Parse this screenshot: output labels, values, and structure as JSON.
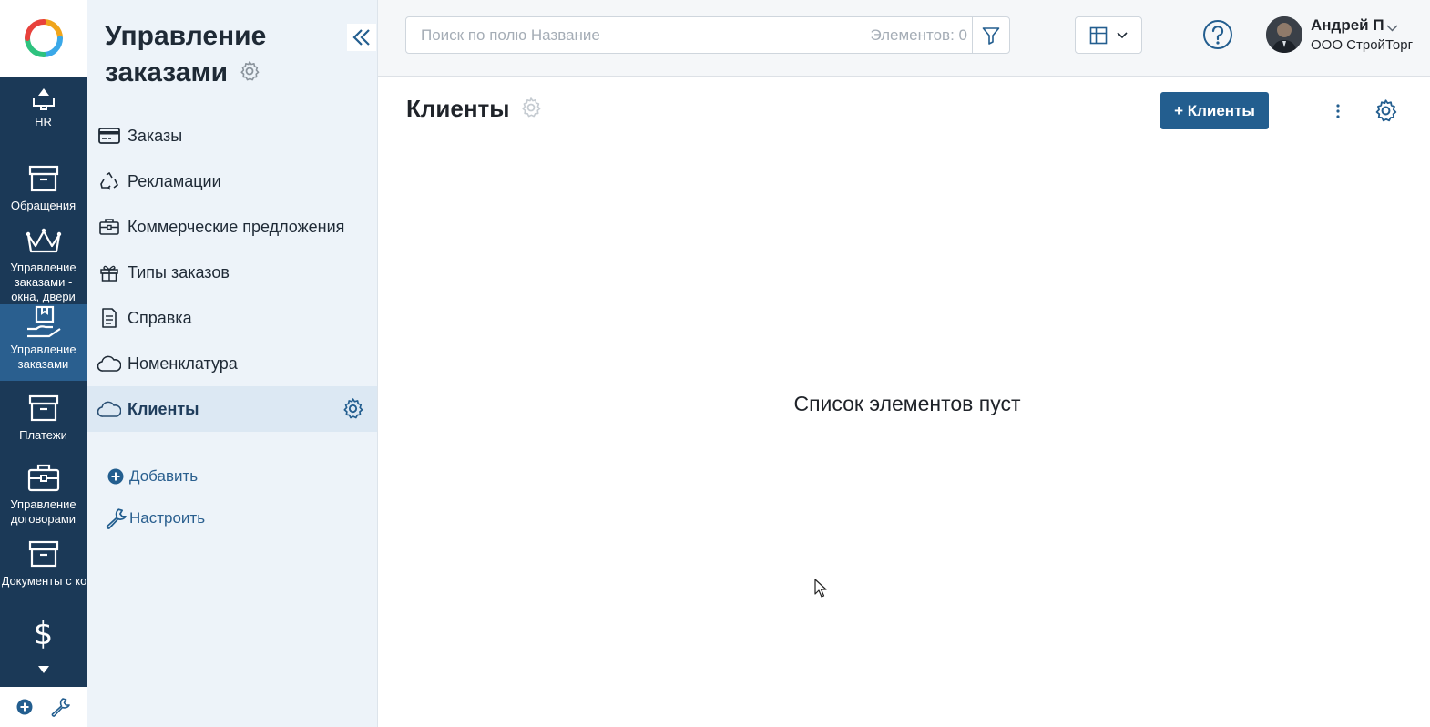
{
  "rail": {
    "items": [
      {
        "label": "HR",
        "icon": "hr-icon"
      },
      {
        "label": "Обращения",
        "icon": "archive-box-icon"
      },
      {
        "label": "Управление заказами - окна, двери",
        "icon": "crown-icon"
      },
      {
        "label": "Управление заказами",
        "icon": "hand-package-icon",
        "active": true
      },
      {
        "label": "Платежи",
        "icon": "archive-box-icon"
      },
      {
        "label": "Управление договорами",
        "icon": "briefcase-icon"
      },
      {
        "label": "Документы с контрагента...",
        "icon": "archive-box-icon"
      },
      {
        "label": "",
        "icon": "dollar-icon"
      }
    ]
  },
  "sidebar": {
    "title": "Управление заказами",
    "items": [
      {
        "label": "Заказы",
        "icon": "card-icon"
      },
      {
        "label": "Рекламации",
        "icon": "recycle-icon"
      },
      {
        "label": "Коммерческие предложения",
        "icon": "briefcase-icon"
      },
      {
        "label": "Типы заказов",
        "icon": "gift-icon"
      },
      {
        "label": "Справка",
        "icon": "document-icon"
      },
      {
        "label": "Номенклатура",
        "icon": "cloud-icon"
      },
      {
        "label": "Клиенты",
        "icon": "cloud-icon",
        "active": true
      }
    ],
    "add_label": "Добавить",
    "configure_label": "Настроить"
  },
  "topbar": {
    "search_placeholder": "Поиск по полю Название",
    "count_label": "Элементов: 0",
    "user_name": "Андрей П",
    "user_company": "ООО СтройТорг"
  },
  "content": {
    "title": "Клиенты",
    "add_button": "+ Клиенты",
    "empty_text": "Список элементов пуст"
  },
  "colors": {
    "rail_bg": "#1b3957",
    "rail_active": "#2a5f8f",
    "sidebar_bg": "#edf3f9",
    "accent": "#235e8f"
  }
}
